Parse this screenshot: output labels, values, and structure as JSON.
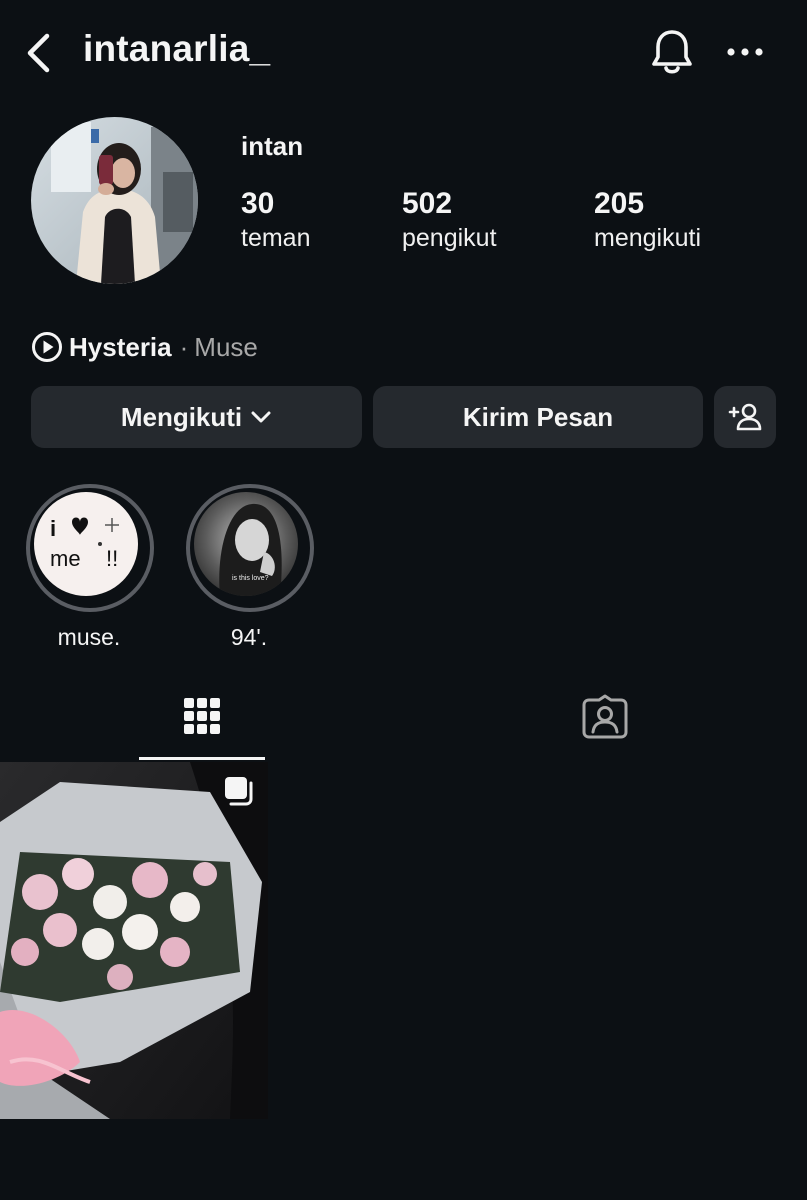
{
  "header": {
    "username": "intanarlia_",
    "icons": {
      "back": "chevron-left-icon",
      "notifications": "bell-icon",
      "more": "ellipsis-icon"
    }
  },
  "profile": {
    "display_name": "intan",
    "stats": [
      {
        "value": "30",
        "label": "teman"
      },
      {
        "value": "502",
        "label": "pengikut"
      },
      {
        "value": "205",
        "label": "mengikuti"
      }
    ]
  },
  "music": {
    "song": "Hysteria",
    "separator": "·",
    "artist": "Muse"
  },
  "actions": {
    "follow_label": "Mengikuti",
    "message_label": "Kirim Pesan",
    "add_friend_icon": "add-person-icon"
  },
  "highlights": [
    {
      "title": "muse.",
      "cover_text_1": "i",
      "cover_text_2": "me",
      "cover_text_3": "!!"
    },
    {
      "title": "94'.",
      "cover_caption": "is this love?"
    }
  ],
  "tabs": [
    {
      "name": "posts",
      "icon": "grid-icon",
      "active": true
    },
    {
      "name": "tagged",
      "icon": "tagged-person-icon",
      "active": false
    }
  ],
  "colors": {
    "background": "#0c1014",
    "button_bg": "#25292e",
    "text_primary": "#f5f5f5",
    "text_secondary": "#a8a8a8",
    "highlight_ring": "#5a5d63"
  }
}
